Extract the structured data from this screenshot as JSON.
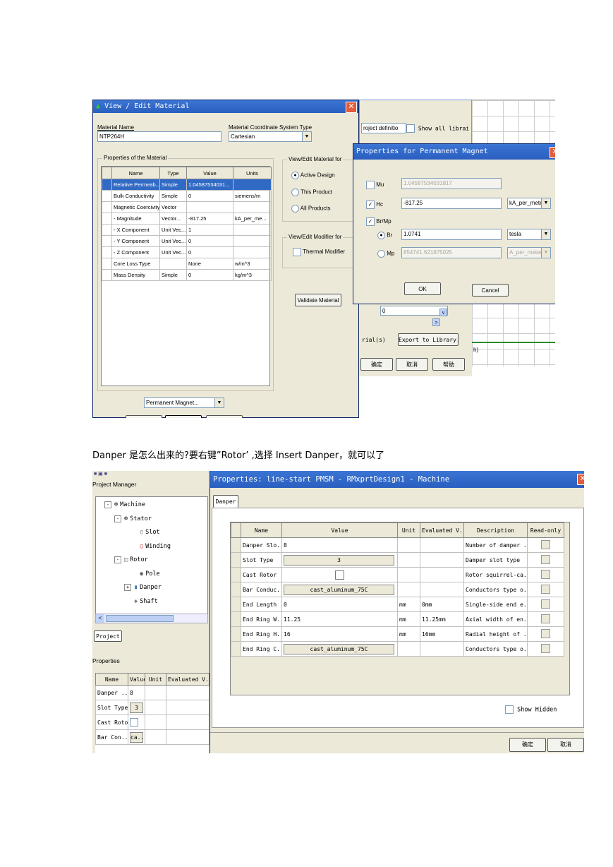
{
  "caption": "Danper 是怎么出来的?要右键”Rotor’ ,选择  Insert Danper，就可以了",
  "fig1": {
    "edit": {
      "title": "View / Edit Material",
      "material_name_label": "Material Name",
      "material_name": "NTP264H",
      "coord_label": "Material Coordinate System Type",
      "coord_value": "Cartesian",
      "props_group": "Properties of the Material",
      "columns": [
        "Name",
        "Type",
        "Value",
        "Units"
      ],
      "rows": [
        [
          "Relative Permeab...",
          "Simple",
          "1.04587534031...",
          ""
        ],
        [
          "Bulk Conductivity",
          "Simple",
          "0",
          "siemens/m"
        ],
        [
          "Magnetic Coercivity",
          "Vector",
          "",
          ""
        ],
        [
          "- Magnitude",
          "Vector...",
          "-817.25",
          "kA_per_me..."
        ],
        [
          "- X Component",
          "Unit Vec...",
          "1",
          ""
        ],
        [
          "- Y Component",
          "Unit Vec...",
          "0",
          ""
        ],
        [
          "- Z Component",
          "Unit Vec...",
          "0",
          ""
        ],
        [
          "Core Loss Type",
          "",
          "None",
          "w/m^3"
        ],
        [
          "Mass Density",
          "Simple",
          "0",
          "kg/m^3"
        ]
      ],
      "view_group": "View/Edit Material for",
      "radios": [
        "Active Design",
        "This Product",
        "All Products"
      ],
      "modifier_group": "View/Edit Modifier for",
      "thermal": "Thermal Modifier",
      "validate": "Validate Material",
      "bottom_select": "Permanent Magnet..."
    },
    "lib": {
      "filter": "roject definitio",
      "show_all": "Show all librai",
      "value": "0",
      "export_left": "rial(s)",
      "export_btn": "Export to Library...",
      "ok": "确定",
      "cancel": "取消",
      "help": "帮助",
      "paren": "h)"
    },
    "pm": {
      "title": "Properties for Permanent Magnet",
      "mu_label": "Mu",
      "mu_value": "1.04587534031817",
      "hc_label": "Hc",
      "hc_value": "-817.25",
      "hc_unit": "kA_per_meter",
      "brmp_label": "Br/Mp",
      "br_label": "Br",
      "br_value": "1.0741",
      "br_unit": "tesla",
      "mp_label": "Mp",
      "mp_value": "854741.621875025",
      "mp_unit": "A_per_meter",
      "ok": "OK",
      "cancel": "Cancel"
    }
  },
  "fig2": {
    "pm_title": "Project Manager",
    "tree": [
      "Machine",
      "Stator",
      "Slot",
      "Winding",
      "Rotor",
      "Pole",
      "Danper",
      "Shaft"
    ],
    "project_tab": "Project",
    "props_title": "Properties",
    "small_cols": [
      "Name",
      "Value",
      "Unit",
      "Evaluated V..."
    ],
    "small_rows": [
      [
        "Danper ...",
        "8"
      ],
      [
        "Slot Type",
        "3"
      ],
      [
        "Cast Rotor",
        ""
      ],
      [
        "Bar Con...",
        "ca..."
      ]
    ],
    "dialog_title": "Properties: line-start PMSM - RMxprtDesign1 - Machine",
    "tab": "Danper",
    "columns": [
      "Name",
      "Value",
      "Unit",
      "Evaluated V...",
      "Description",
      "Read-only"
    ],
    "rows": [
      {
        "name": "Danper Slo...",
        "value": "8",
        "unit": "",
        "eval": "",
        "desc": "Number of damper ...",
        "kind": "text"
      },
      {
        "name": "Slot Type",
        "value": "3",
        "unit": "",
        "eval": "",
        "desc": "Damper slot type",
        "kind": "button"
      },
      {
        "name": "Cast Rotor",
        "value": "",
        "unit": "",
        "eval": "",
        "desc": "Rotor squirrel-ca...",
        "kind": "check"
      },
      {
        "name": "Bar Conduc...",
        "value": "cast_aluminum_75C",
        "unit": "",
        "eval": "",
        "desc": "Conductors type o...",
        "kind": "button"
      },
      {
        "name": "End Length",
        "value": "0",
        "unit": "mm",
        "eval": "0mm",
        "desc": "Single-side end e...",
        "kind": "text"
      },
      {
        "name": "End Ring W...",
        "value": "11.25",
        "unit": "mm",
        "eval": "11.25mm",
        "desc": "Axial width of en...",
        "kind": "text"
      },
      {
        "name": "End Ring H...",
        "value": "16",
        "unit": "mm",
        "eval": "16mm",
        "desc": "Radial height of ...",
        "kind": "text"
      },
      {
        "name": "End Ring C...",
        "value": "cast_aluminum_75C",
        "unit": "",
        "eval": "",
        "desc": "Conductors type o...",
        "kind": "button"
      }
    ],
    "show_hidden": "Show Hidden",
    "ok": "确定",
    "cancel": "取消"
  }
}
